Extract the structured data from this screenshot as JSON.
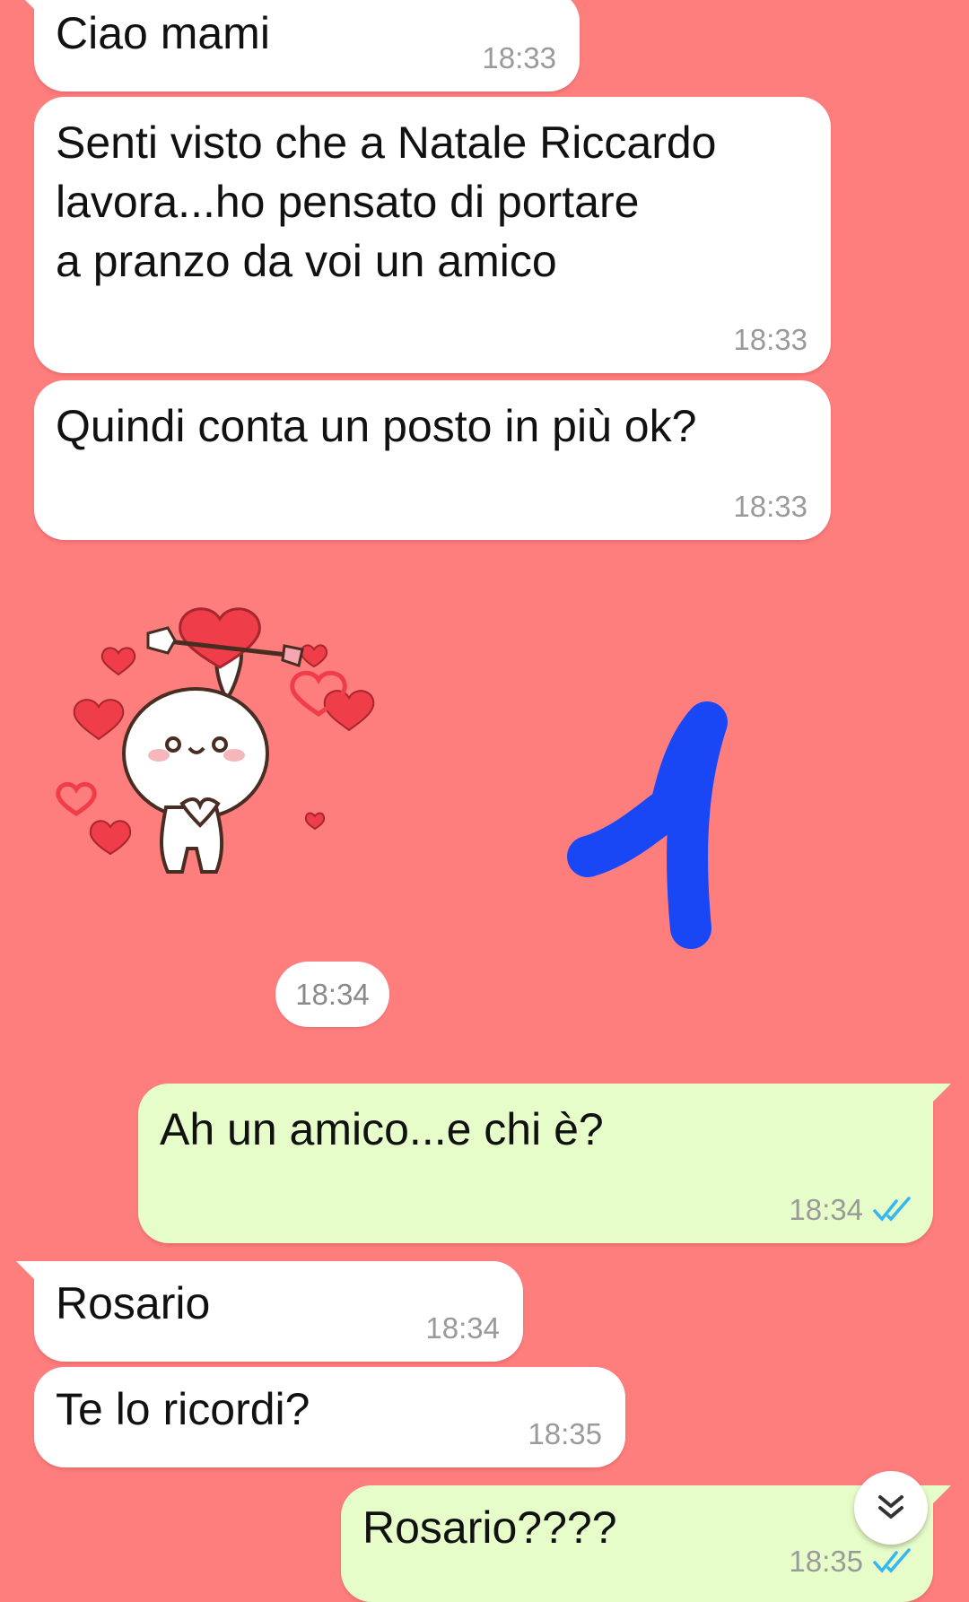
{
  "chat": {
    "messages": [
      {
        "direction": "incoming",
        "text": "Ciao mami",
        "time": "18:33"
      },
      {
        "direction": "incoming",
        "text": "Senti visto che a Natale Riccardo\nlavora...ho pensato di portare\na pranzo da voi un amico",
        "time": "18:33"
      },
      {
        "direction": "incoming",
        "text": "Quindi conta un posto in più ok?",
        "time": "18:33"
      },
      {
        "direction": "incoming",
        "type": "sticker",
        "sticker": "bunny-with-heart-arrow",
        "time": "18:34"
      },
      {
        "direction": "outgoing",
        "text": "Ah un amico...e chi è?",
        "time": "18:34",
        "status": "read"
      },
      {
        "direction": "incoming",
        "text": "Rosario",
        "time": "18:34"
      },
      {
        "direction": "incoming",
        "text": "Te lo ricordi?",
        "time": "18:35"
      },
      {
        "direction": "outgoing",
        "text": "Rosario????",
        "time": "18:35",
        "status": "read"
      }
    ]
  },
  "annotation": {
    "drawn_text": "1",
    "color": "#1a47f5"
  },
  "icons": {
    "read_ticks": "double-check-icon",
    "scroll_down": "double-chevron-down-icon"
  },
  "colors": {
    "background": "#fe7e7e",
    "incoming_bubble": "#ffffff",
    "outgoing_bubble": "#e6fdc9",
    "read_tick": "#34b7f1"
  }
}
